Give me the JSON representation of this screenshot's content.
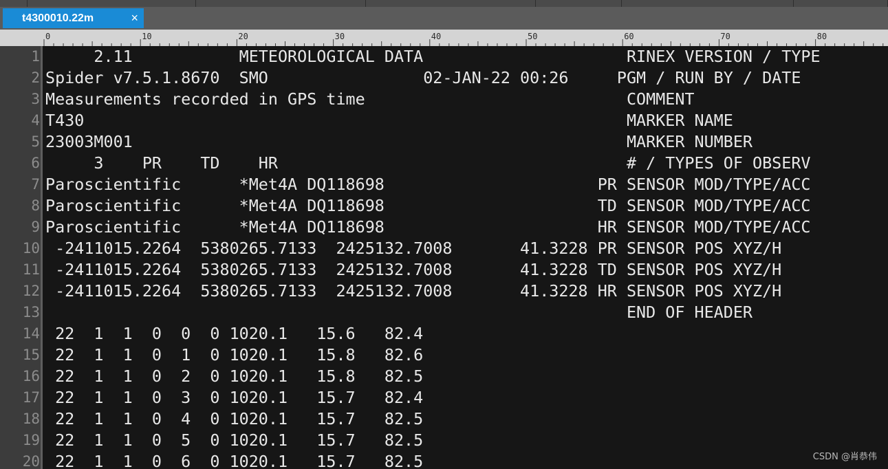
{
  "tab": {
    "title": "t4300010.22m",
    "close_glyph": "×"
  },
  "ruler": {
    "labels": [
      "0",
      "10",
      "20",
      "30",
      "40",
      "50",
      "60",
      "70",
      "80"
    ]
  },
  "editor": {
    "line_numbers": [
      "1",
      "2",
      "3",
      "4",
      "5",
      "6",
      "7",
      "8",
      "9",
      "10",
      "11",
      "12",
      "13",
      "14",
      "15",
      "16",
      "17",
      "18",
      "19",
      "20"
    ],
    "lines": [
      "     2.11           METEOROLOGICAL DATA                     RINEX VERSION / TYPE",
      "Spider v7.5.1.8670  SMO                02-JAN-22 00:26     PGM / RUN BY / DATE",
      "Measurements recorded in GPS time                           COMMENT",
      "T430                                                        MARKER NAME",
      "23003M001                                                   MARKER NUMBER",
      "     3    PR    TD    HR                                    # / TYPES OF OBSERV",
      "Paroscientific      *Met4A DQ118698                      PR SENSOR MOD/TYPE/ACC",
      "Paroscientific      *Met4A DQ118698                      TD SENSOR MOD/TYPE/ACC",
      "Paroscientific      *Met4A DQ118698                      HR SENSOR MOD/TYPE/ACC",
      " -2411015.2264  5380265.7133  2425132.7008       41.3228 PR SENSOR POS XYZ/H",
      " -2411015.2264  5380265.7133  2425132.7008       41.3228 TD SENSOR POS XYZ/H",
      " -2411015.2264  5380265.7133  2425132.7008       41.3228 HR SENSOR POS XYZ/H",
      "                                                            END OF HEADER",
      " 22  1  1  0  0  0 1020.1   15.6   82.4",
      " 22  1  1  0  1  0 1020.1   15.8   82.6",
      " 22  1  1  0  2  0 1020.1   15.8   82.5",
      " 22  1  1  0  3  0 1020.1   15.7   82.4",
      " 22  1  1  0  4  0 1020.1   15.7   82.5",
      " 22  1  1  0  5  0 1020.1   15.7   82.5",
      " 22  1  1  0  6  0 1020.1   15.7   82.5"
    ]
  },
  "watermark": "CSDN @肖恭伟",
  "colors": {
    "tab_active": "#1a8bd6",
    "editor_bg": "#161616",
    "text": "#e8e8e8",
    "line_number": "#8c8c8c"
  }
}
